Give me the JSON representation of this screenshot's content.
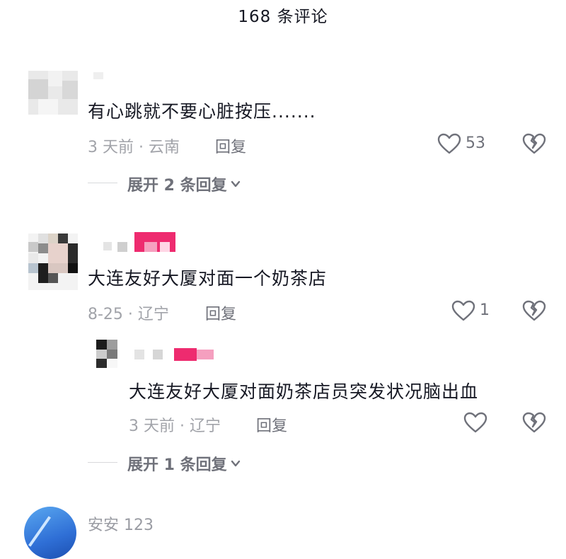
{
  "header": {
    "title": "168 条评论"
  },
  "comments": [
    {
      "text": "有心跳就不要心脏按压.......",
      "date": "3 天前",
      "location": "云南",
      "reply_label": "回复",
      "likes": "53",
      "expand_label": "展开 2 条回复"
    },
    {
      "text": "大连友好大厦对面一个奶茶店",
      "date": "8-25",
      "location": "辽宁",
      "reply_label": "回复",
      "likes": "1",
      "reply": {
        "text": "大连友好大厦对面奶茶店员突发状况脑出血",
        "date": "3 天前",
        "location": "辽宁",
        "reply_label": "回复"
      },
      "expand_label": "展开 1 条回复"
    },
    {
      "username": "安安 123"
    }
  ],
  "meta_separator": " · ",
  "colors": {
    "accent_pink": "#ee2b6f",
    "text": "#161823",
    "muted": "#a1a3a9"
  },
  "icons": [
    "heart-outline-icon",
    "broken-heart-icon",
    "chevron-down-icon"
  ]
}
